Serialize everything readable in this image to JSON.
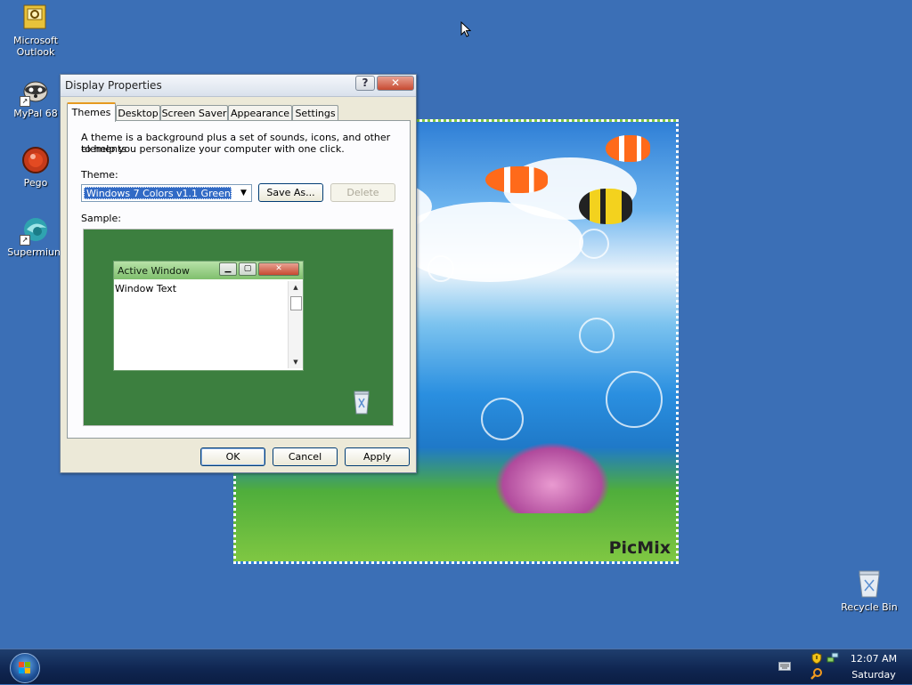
{
  "desktop_icons": [
    {
      "label_l1": "Microsoft",
      "label_l2": "Outlook",
      "icon": "outlook-icon"
    },
    {
      "label_l1": "MyPal 68",
      "icon": "mypal-icon"
    },
    {
      "label_l1": "Pego",
      "icon": "pego-icon"
    },
    {
      "label_l1": "Supermium",
      "icon": "supermium-icon"
    }
  ],
  "recycle_bin": {
    "label": "Recycle Bin",
    "icon": "recycle-bin-icon"
  },
  "wallpaper": {
    "logo": "PicMix"
  },
  "dialog": {
    "title": "Display Properties",
    "help_glyph": "?",
    "close_glyph": "✕",
    "tabs": [
      "Themes",
      "Desktop",
      "Screen Saver",
      "Appearance",
      "Settings"
    ],
    "active_tab": "Themes",
    "description_l1": "A theme is a background plus a set of sounds, icons, and other elements",
    "description_l2": "to help you personalize your computer with one click.",
    "theme_label": "Theme:",
    "theme_value": "Windows 7 Colors v1.1 Green",
    "save_as_label": "Save As...",
    "delete_label": "Delete",
    "sample_label": "Sample:",
    "sample": {
      "window_title": "Active Window",
      "window_text": "Window Text",
      "accent_color": "#3c7f3f"
    },
    "ok_label": "OK",
    "cancel_label": "Cancel",
    "apply_label": "Apply"
  },
  "taskbar": {
    "clock_time": "12:07 AM",
    "clock_day": "Saturday"
  }
}
